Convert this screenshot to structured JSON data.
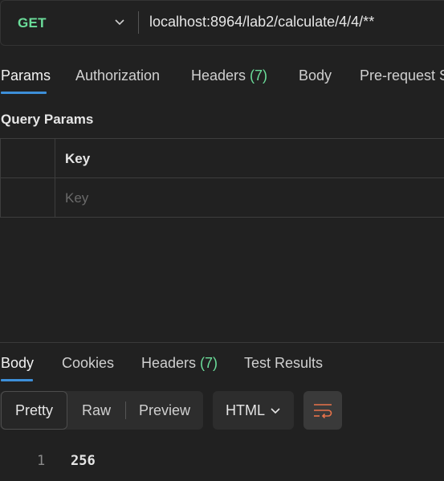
{
  "request": {
    "method": "GET",
    "url": "localhost:8964/lab2/calculate/4/4/**"
  },
  "request_tabs": [
    {
      "label": "Params",
      "count": "",
      "active": true
    },
    {
      "label": "Authorization",
      "count": "",
      "active": false
    },
    {
      "label": "Headers ",
      "count": "(7)",
      "active": false
    },
    {
      "label": "Body",
      "count": "",
      "active": false
    },
    {
      "label": "Pre-request S",
      "count": "",
      "active": false
    }
  ],
  "query_params": {
    "title": "Query Params",
    "column_header": "Key",
    "key_placeholder": "Key"
  },
  "response_tabs": [
    {
      "label": "Body",
      "count": "",
      "active": true
    },
    {
      "label": "Cookies",
      "count": "",
      "active": false
    },
    {
      "label": "Headers ",
      "count": "(7)",
      "active": false
    },
    {
      "label": "Test Results",
      "count": "",
      "active": false
    }
  ],
  "response_view": {
    "modes": [
      "Pretty",
      "Raw",
      "Preview"
    ],
    "selected_mode": "Pretty",
    "format": "HTML"
  },
  "response_body": [
    {
      "line": "1",
      "text": "256"
    }
  ],
  "colors": {
    "method_get": "#6bdd9a",
    "tab_count": "#6bdd9a",
    "active_underline": "#3d8fd8",
    "wrap_icon": "#e8734a"
  },
  "icons": {
    "method_dropdown": "chevron-down-icon",
    "format_dropdown": "chevron-down-icon",
    "wrap": "wrap-lines-icon"
  }
}
